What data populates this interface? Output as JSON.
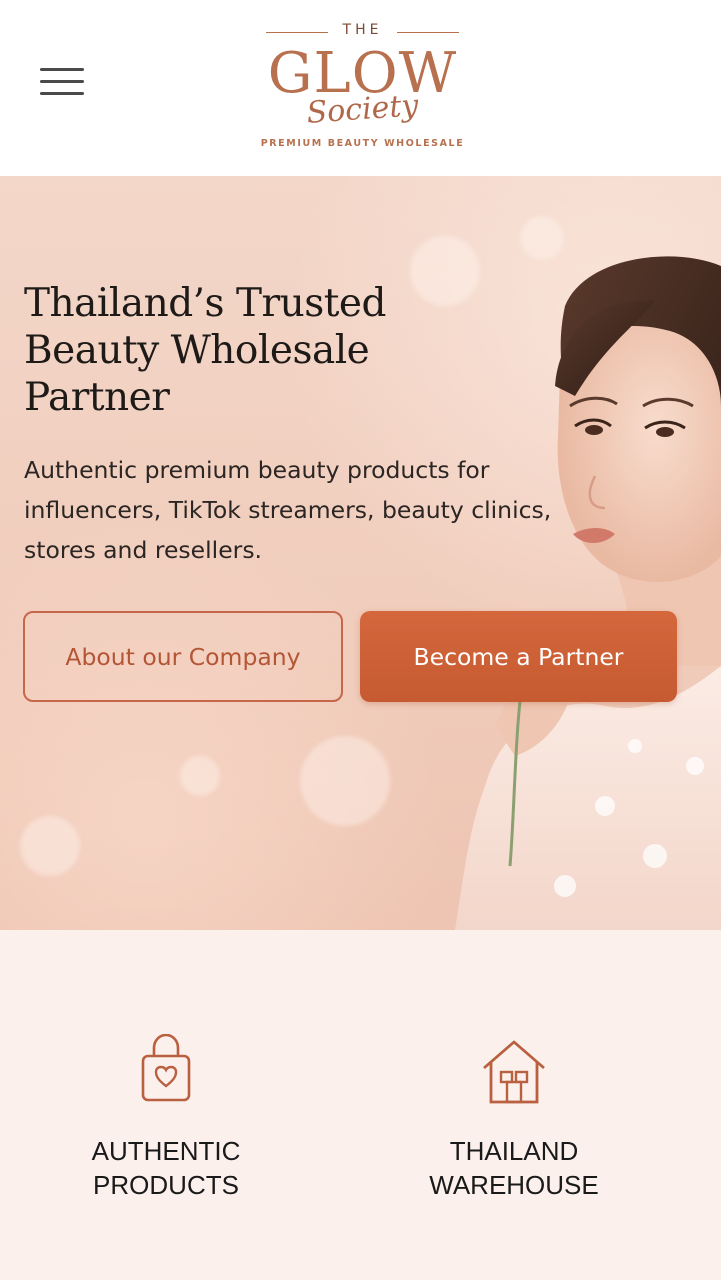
{
  "header": {
    "menu_icon": "hamburger-menu-icon",
    "logo": {
      "the": "THE",
      "glow": "GLOW",
      "society": "Society",
      "tagline": "PREMIUM BEAUTY WHOLESALE"
    }
  },
  "hero": {
    "title": "Thailand’s Trusted Beauty Wholesale Partner",
    "description": "Authentic premium beauty products for influencers, TikTok streamers, beauty clinics, stores and resellers.",
    "primary_button": "About our Company",
    "secondary_button": "Become a Partner"
  },
  "features": [
    {
      "icon": "shopping-bag-heart-icon",
      "label": "AUTHENTIC\nPRODUCTS"
    },
    {
      "icon": "warehouse-icon",
      "label": "THAILAND\nWAREHOUSE"
    }
  ],
  "colors": {
    "accent": "#c65a30",
    "outline": "#c7674a",
    "logo": "#b8714f",
    "hero_bg": "#f1cfbf",
    "features_bg": "#fcf0ec"
  }
}
